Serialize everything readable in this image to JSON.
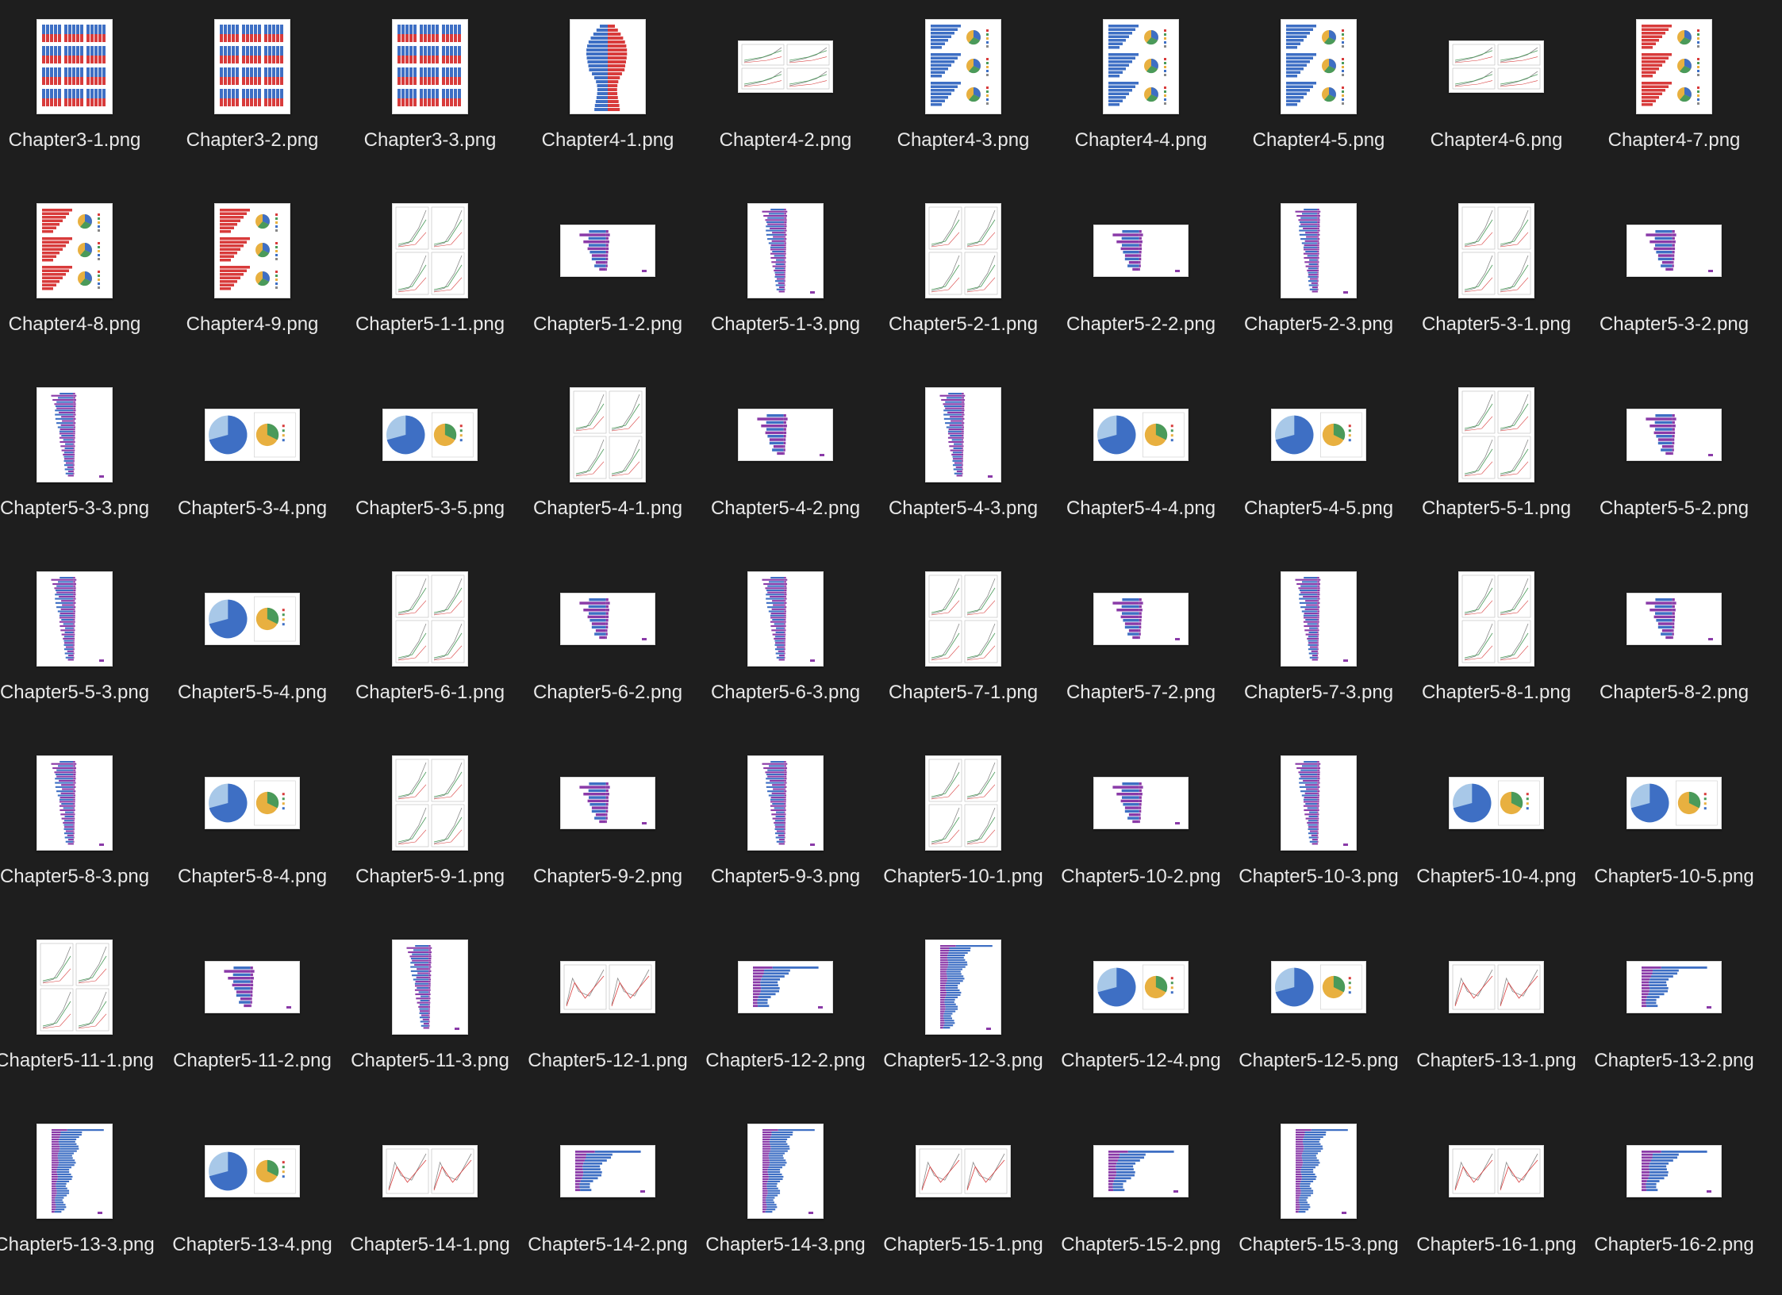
{
  "window": {
    "view": "icon-grid",
    "background": "#1e1e1e"
  },
  "files": [
    {
      "name": "Chapter3-1.png",
      "kind": "stacked-panels"
    },
    {
      "name": "Chapter3-2.png",
      "kind": "stacked-panels"
    },
    {
      "name": "Chapter3-3.png",
      "kind": "stacked-panels"
    },
    {
      "name": "Chapter4-1.png",
      "kind": "pyramid"
    },
    {
      "name": "Chapter4-2.png",
      "kind": "lines-grid"
    },
    {
      "name": "Chapter4-3.png",
      "kind": "bars-pie-blue"
    },
    {
      "name": "Chapter4-4.png",
      "kind": "bars-pie-blue"
    },
    {
      "name": "Chapter4-5.png",
      "kind": "bars-pie-blue"
    },
    {
      "name": "Chapter4-6.png",
      "kind": "lines-grid"
    },
    {
      "name": "Chapter4-7.png",
      "kind": "bars-pie-red"
    },
    {
      "name": "Chapter4-8.png",
      "kind": "bars-pie-red"
    },
    {
      "name": "Chapter4-9.png",
      "kind": "bars-pie-red"
    },
    {
      "name": "Chapter5-1-1.png",
      "kind": "lines-grid"
    },
    {
      "name": "Chapter5-1-2.png",
      "kind": "diverging-wide"
    },
    {
      "name": "Chapter5-1-3.png",
      "kind": "diverging-tall"
    },
    {
      "name": "Chapter5-2-1.png",
      "kind": "lines-grid"
    },
    {
      "name": "Chapter5-2-2.png",
      "kind": "diverging-wide"
    },
    {
      "name": "Chapter5-2-3.png",
      "kind": "diverging-tall"
    },
    {
      "name": "Chapter5-3-1.png",
      "kind": "lines-grid"
    },
    {
      "name": "Chapter5-3-2.png",
      "kind": "diverging-wide"
    },
    {
      "name": "Chapter5-3-3.png",
      "kind": "diverging-tall"
    },
    {
      "name": "Chapter5-3-4.png",
      "kind": "pies"
    },
    {
      "name": "Chapter5-3-5.png",
      "kind": "pies"
    },
    {
      "name": "Chapter5-4-1.png",
      "kind": "lines-grid"
    },
    {
      "name": "Chapter5-4-2.png",
      "kind": "diverging-wide"
    },
    {
      "name": "Chapter5-4-3.png",
      "kind": "diverging-tall"
    },
    {
      "name": "Chapter5-4-4.png",
      "kind": "pies"
    },
    {
      "name": "Chapter5-4-5.png",
      "kind": "pies"
    },
    {
      "name": "Chapter5-5-1.png",
      "kind": "lines-grid"
    },
    {
      "name": "Chapter5-5-2.png",
      "kind": "diverging-wide"
    },
    {
      "name": "Chapter5-5-3.png",
      "kind": "diverging-tall"
    },
    {
      "name": "Chapter5-5-4.png",
      "kind": "pies"
    },
    {
      "name": "Chapter5-6-1.png",
      "kind": "lines-grid"
    },
    {
      "name": "Chapter5-6-2.png",
      "kind": "diverging-wide"
    },
    {
      "name": "Chapter5-6-3.png",
      "kind": "diverging-tall"
    },
    {
      "name": "Chapter5-7-1.png",
      "kind": "lines-grid"
    },
    {
      "name": "Chapter5-7-2.png",
      "kind": "diverging-wide"
    },
    {
      "name": "Chapter5-7-3.png",
      "kind": "diverging-tall"
    },
    {
      "name": "Chapter5-8-1.png",
      "kind": "lines-grid"
    },
    {
      "name": "Chapter5-8-2.png",
      "kind": "diverging-wide"
    },
    {
      "name": "Chapter5-8-3.png",
      "kind": "diverging-tall"
    },
    {
      "name": "Chapter5-8-4.png",
      "kind": "pies"
    },
    {
      "name": "Chapter5-9-1.png",
      "kind": "lines-grid"
    },
    {
      "name": "Chapter5-9-2.png",
      "kind": "diverging-wide"
    },
    {
      "name": "Chapter5-9-3.png",
      "kind": "diverging-tall"
    },
    {
      "name": "Chapter5-10-1.png",
      "kind": "lines-grid"
    },
    {
      "name": "Chapter5-10-2.png",
      "kind": "diverging-wide"
    },
    {
      "name": "Chapter5-10-3.png",
      "kind": "diverging-tall"
    },
    {
      "name": "Chapter5-10-4.png",
      "kind": "pies"
    },
    {
      "name": "Chapter5-10-5.png",
      "kind": "pies"
    },
    {
      "name": "Chapter5-11-1.png",
      "kind": "lines-grid"
    },
    {
      "name": "Chapter5-11-2.png",
      "kind": "diverging-wide"
    },
    {
      "name": "Chapter5-11-3.png",
      "kind": "diverging-tall"
    },
    {
      "name": "Chapter5-12-1.png",
      "kind": "lines-wide"
    },
    {
      "name": "Chapter5-12-2.png",
      "kind": "hbars-wide"
    },
    {
      "name": "Chapter5-12-3.png",
      "kind": "hbars-tall"
    },
    {
      "name": "Chapter5-12-4.png",
      "kind": "pies"
    },
    {
      "name": "Chapter5-12-5.png",
      "kind": "pies"
    },
    {
      "name": "Chapter5-13-1.png",
      "kind": "lines-wide"
    },
    {
      "name": "Chapter5-13-2.png",
      "kind": "hbars-wide"
    },
    {
      "name": "Chapter5-13-3.png",
      "kind": "hbars-tall"
    },
    {
      "name": "Chapter5-13-4.png",
      "kind": "pies"
    },
    {
      "name": "Chapter5-14-1.png",
      "kind": "lines-wide"
    },
    {
      "name": "Chapter5-14-2.png",
      "kind": "hbars-wide"
    },
    {
      "name": "Chapter5-14-3.png",
      "kind": "hbars-tall"
    },
    {
      "name": "Chapter5-15-1.png",
      "kind": "lines-wide"
    },
    {
      "name": "Chapter5-15-2.png",
      "kind": "hbars-wide"
    },
    {
      "name": "Chapter5-15-3.png",
      "kind": "hbars-tall"
    },
    {
      "name": "Chapter5-16-1.png",
      "kind": "lines-wide"
    },
    {
      "name": "Chapter5-16-2.png",
      "kind": "hbars-wide"
    }
  ],
  "colors": {
    "label_text": "#e8e8e8",
    "red": "#d83b3b",
    "blue": "#3e6fc4",
    "purple": "#8a3aa8",
    "light_blue": "#a8c8e8"
  }
}
